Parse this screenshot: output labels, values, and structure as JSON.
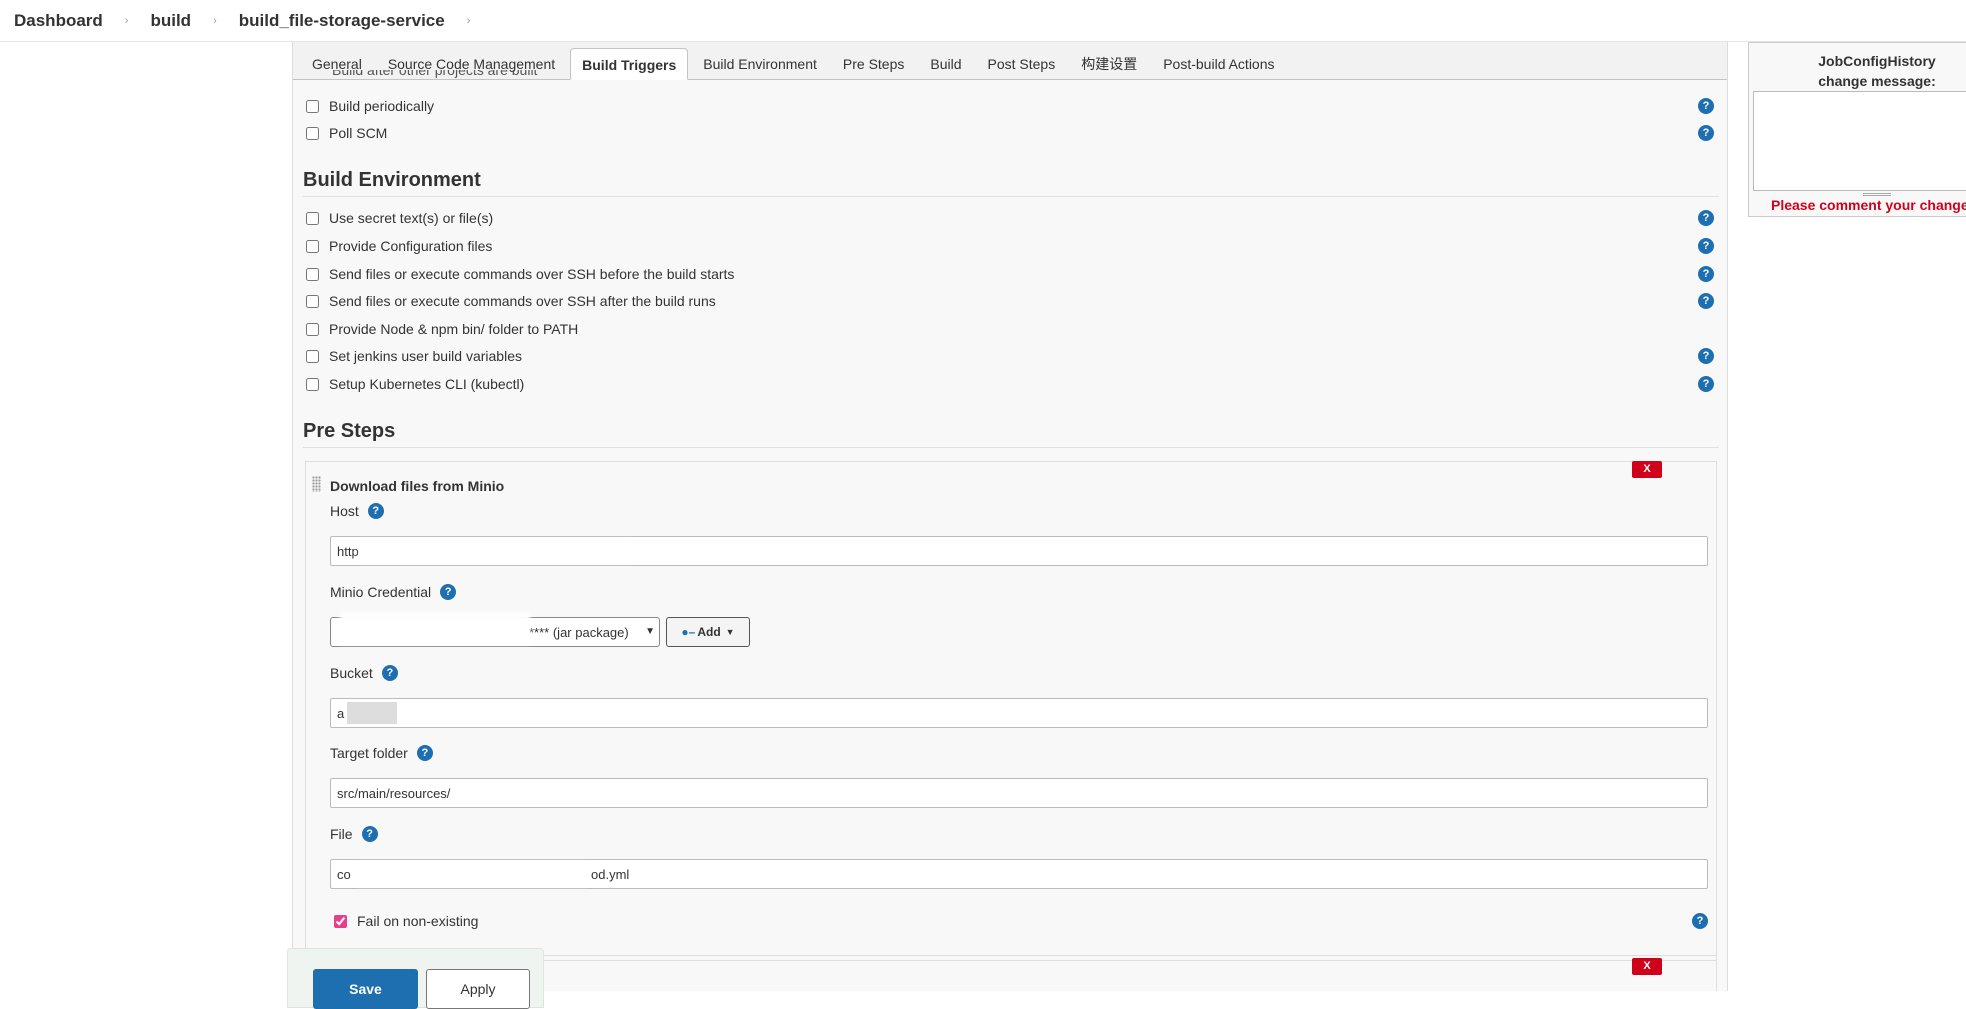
{
  "breadcrumb": [
    "Dashboard",
    "build",
    "build_file-storage-service"
  ],
  "tabs": [
    "General",
    "Source Code Management",
    "Build Triggers",
    "Build Environment",
    "Pre Steps",
    "Build",
    "Post Steps",
    "构建设置",
    "Post-build Actions"
  ],
  "active_tab": "Build Triggers",
  "build_triggers": {
    "cutoff_label": "Build after other projects are built",
    "items": [
      "Build periodically",
      "Poll SCM"
    ]
  },
  "build_environment": {
    "title": "Build Environment",
    "items": [
      "Use secret text(s) or file(s)",
      "Provide Configuration files",
      "Send files or execute commands over SSH before the build starts",
      "Send files or execute commands over SSH after the build runs",
      "Provide Node & npm bin/ folder to PATH",
      "Set jenkins user build variables",
      "Setup Kubernetes CLI (kubectl)"
    ]
  },
  "pre_steps": {
    "title": "Pre Steps",
    "step_title": "Download files from Minio",
    "remove_label": "X",
    "host_label": "Host",
    "host_value": "http",
    "credential_label": "Minio Credential",
    "credential_value": "**** (jar package)",
    "add_label": "Add",
    "bucket_label": "Bucket",
    "bucket_value": "a",
    "target_folder_label": "Target folder",
    "target_folder_value": "src/main/resources/",
    "file_label": "File",
    "file_value": "co",
    "file_value_suffix": "od.yml",
    "fail_label": "Fail on non-existing"
  },
  "help_glyph": "?",
  "buttons": {
    "save": "Save",
    "apply": "Apply"
  },
  "job_config_history": {
    "title": "JobConfigHistory",
    "subtitle": "change message:",
    "warning": "Please comment your change"
  },
  "colors": {
    "primary": "#1d6fb0",
    "danger": "#d0021b",
    "checkbox_accent": "#e83e8c"
  }
}
